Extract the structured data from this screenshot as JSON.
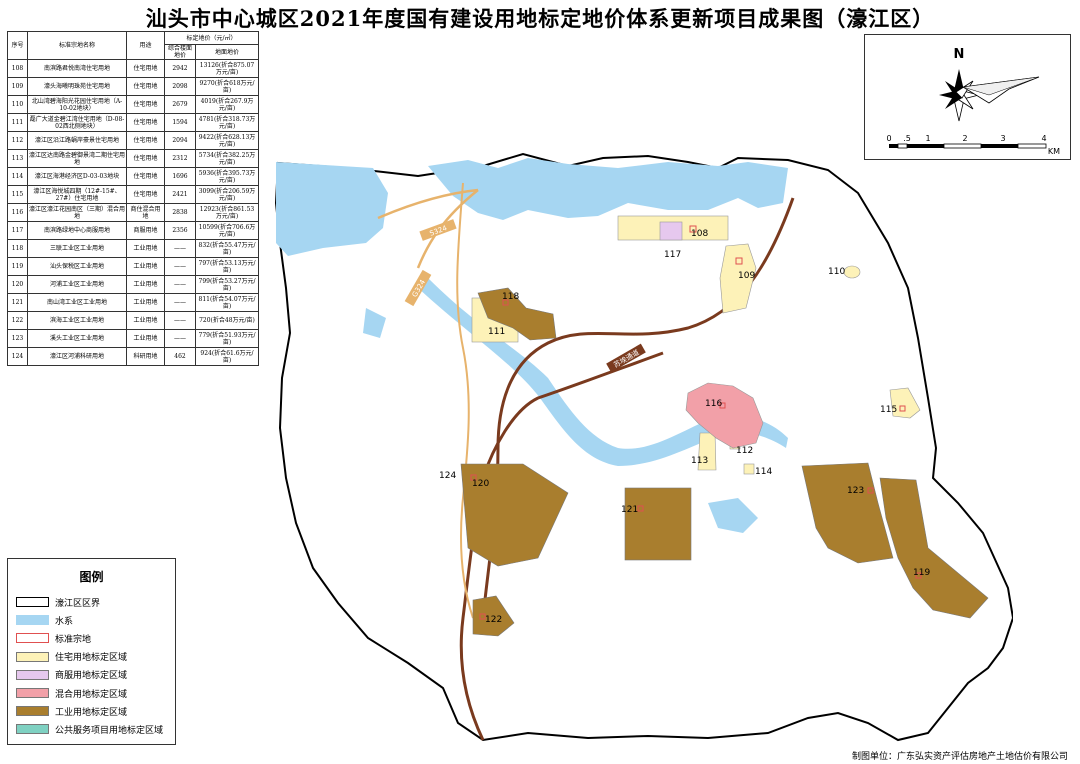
{
  "title": "汕头市中心城区2021年度国有建设用地标定地价体系更新项目成果图（濠江区）",
  "table": {
    "headers": {
      "seq": "序号",
      "name": "标准宗地名称",
      "use": "用途",
      "price_group": "标定地价（元/㎡）",
      "floor_price": "综合楼面地价",
      "land_price": "地面地价"
    },
    "rows": [
      {
        "id": "108",
        "name": "南滨路君悦南湾住宅用地",
        "use": "住宅用地",
        "floor": "2942",
        "land": "13126(折合875.07万元/亩)"
      },
      {
        "id": "109",
        "name": "濠头海曦明珠苑住宅用地",
        "use": "住宅用地",
        "floor": "2098",
        "land": "9270(折合618万元/亩)"
      },
      {
        "id": "110",
        "name": "北山湾碧海阳光花园住宅用地（A-10-02地块）",
        "use": "住宅用地",
        "floor": "2679",
        "land": "4019(折合267.9万元/亩)"
      },
      {
        "id": "111",
        "name": "磊广大道金碧江湾住宅用地（D-08-02西北侧地块）",
        "use": "住宅用地",
        "floor": "1594",
        "land": "4781(折合318.73万元/亩)"
      },
      {
        "id": "112",
        "name": "濠江区沿江路蜗岸豪景住宅用地",
        "use": "住宅用地",
        "floor": "2094",
        "land": "9422(折合628.13万元/亩)"
      },
      {
        "id": "113",
        "name": "濠江区达南路金碧御景湾二期住宅用地",
        "use": "住宅用地",
        "floor": "2312",
        "land": "5734(折合382.25万元/亩)"
      },
      {
        "id": "114",
        "name": "濠江区海港经济区D-03-03地块",
        "use": "住宅用地",
        "floor": "1696",
        "land": "5936(折合395.73万元/亩)"
      },
      {
        "id": "115",
        "name": "濠江区海悦城四期（12#-15#、27#）住宅用地",
        "use": "住宅用地",
        "floor": "2421",
        "land": "3099(折合206.59万元/亩)"
      },
      {
        "id": "116",
        "name": "濠江区濠江花园南区（三期）混合用地",
        "use": "商住混合用地",
        "floor": "2838",
        "land": "12923(折合861.53万元/亩)"
      },
      {
        "id": "117",
        "name": "南滨路绿地中心商服用地",
        "use": "商服用地",
        "floor": "2356",
        "land": "10599(折合706.6万元/亩)"
      },
      {
        "id": "118",
        "name": "三联工业区工业用地",
        "use": "工业用地",
        "floor": "——",
        "land": "832(折合55.47万元/亩)"
      },
      {
        "id": "119",
        "name": "汕头保税区工业用地",
        "use": "工业用地",
        "floor": "——",
        "land": "797(折合53.13万元/亩)"
      },
      {
        "id": "120",
        "name": "河浦工业区工业用地",
        "use": "工业用地",
        "floor": "——",
        "land": "799(折合53.27万元/亩)"
      },
      {
        "id": "121",
        "name": "南山湾工业区工业用地",
        "use": "工业用地",
        "floor": "——",
        "land": "811(折合54.07万元/亩)"
      },
      {
        "id": "122",
        "name": "滨海工业区工业用地",
        "use": "工业用地",
        "floor": "——",
        "land": "720(折合48万元/亩)"
      },
      {
        "id": "123",
        "name": "溪头工业区工业用地",
        "use": "工业用地",
        "floor": "——",
        "land": "779(折合51.93万元/亩)"
      },
      {
        "id": "124",
        "name": "濠江区河浦科研用地",
        "use": "科研用地",
        "floor": "462",
        "land": "924(折合61.6万元/亩)"
      }
    ]
  },
  "legend": {
    "title": "图例",
    "items": [
      {
        "label": "濠江区区界",
        "color": "#ffffff",
        "border": "#000000"
      },
      {
        "label": "水系",
        "color": "#a6d6f2",
        "border": "#a6d6f2"
      },
      {
        "label": "标准宗地",
        "color": "#ffffff",
        "border": "#e05050"
      },
      {
        "label": "住宅用地标定区域",
        "color": "#fdf2b8",
        "border": "#999999"
      },
      {
        "label": "商服用地标定区域",
        "color": "#e6c8ee",
        "border": "#999999"
      },
      {
        "label": "混合用地标定区域",
        "color": "#f2a0a8",
        "border": "#999999"
      },
      {
        "label": "工业用地标定区域",
        "color": "#a97e2e",
        "border": "#777777"
      },
      {
        "label": "公共服务项目用地标定区域",
        "color": "#7fd1c2",
        "border": "#999999"
      }
    ]
  },
  "compass": {
    "north": "N",
    "ticks": [
      "0",
      ".5",
      "1",
      "2",
      "3",
      "4"
    ],
    "unit": "KM"
  },
  "roads": {
    "r1": "S324",
    "r2": "G324",
    "r3": "苏埃通道"
  },
  "map_labels": {
    "p108": "108",
    "p109": "109",
    "p110": "110",
    "p111": "111",
    "p112": "112",
    "p113": "113",
    "p114": "114",
    "p115": "115",
    "p116": "116",
    "p117": "117",
    "p118": "118",
    "p119": "119",
    "p120": "120",
    "p121": "121",
    "p122": "122",
    "p123": "123",
    "p124": "124"
  },
  "credit": "制图单位：广东弘实资产评估房地产土地估价有限公司",
  "colors": {
    "water": "#a6d6f2",
    "residential": "#fdf2b8",
    "commercial": "#e6c8ee",
    "mixed": "#f2a0a8",
    "industrial": "#a97e2e",
    "road": "#7a3a1e",
    "boundary": "#000000"
  }
}
